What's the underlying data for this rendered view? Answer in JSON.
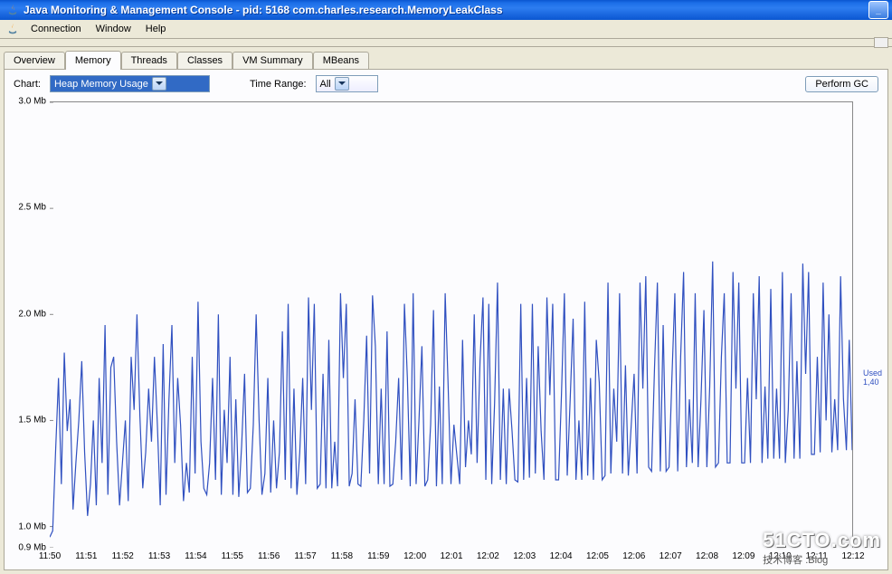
{
  "window": {
    "title": "Java Monitoring & Management Console - pid: 5168 com.charles.research.MemoryLeakClass"
  },
  "menubar": {
    "items": [
      "Connection",
      "Window",
      "Help"
    ]
  },
  "tabs": {
    "items": [
      "Overview",
      "Memory",
      "Threads",
      "Classes",
      "VM Summary",
      "MBeans"
    ],
    "active": 1
  },
  "controls": {
    "chart_label": "Chart:",
    "chart_value": "Heap Memory Usage",
    "time_label": "Time Range:",
    "time_value": "All",
    "gc_button": "Perform GC"
  },
  "sidelabel": {
    "l1": "Used",
    "l2": "1,40"
  },
  "watermark": {
    "main": "51CTO.com",
    "sub": "技术博客 .Blog"
  },
  "chart_data": {
    "type": "line",
    "title": "",
    "xlabel": "",
    "ylabel": "",
    "y_unit": "Mb",
    "ylim": [
      0.9,
      3.0
    ],
    "y_ticks": [
      0.9,
      1.0,
      1.5,
      2.0,
      2.5,
      3.0
    ],
    "y_tick_labels": [
      "0.9 Mb",
      "1.0 Mb",
      "1.5 Mb",
      "2.0 Mb",
      "2.5 Mb",
      "3.0 Mb"
    ],
    "x_tick_labels": [
      "11:50",
      "11:51",
      "11:52",
      "11:53",
      "11:54",
      "11:55",
      "11:56",
      "11:57",
      "11:58",
      "11:59",
      "12:00",
      "12:01",
      "12:02",
      "12:03",
      "12:04",
      "12:05",
      "12:06",
      "12:07",
      "12:08",
      "12:09",
      "12:10",
      "12:11",
      "12:12"
    ],
    "x_range": [
      0,
      276
    ],
    "series": [
      {
        "name": "Used",
        "color": "#3050c0",
        "values": [
          0.95,
          0.98,
          1.35,
          1.7,
          1.2,
          1.82,
          1.45,
          1.6,
          1.08,
          1.3,
          1.5,
          1.78,
          1.35,
          1.05,
          1.2,
          1.5,
          1.1,
          1.7,
          1.3,
          1.95,
          1.15,
          1.75,
          1.8,
          1.4,
          1.1,
          1.3,
          1.5,
          1.12,
          1.8,
          1.55,
          2.0,
          1.52,
          1.18,
          1.35,
          1.65,
          1.4,
          1.8,
          1.48,
          1.1,
          1.86,
          1.15,
          1.6,
          1.95,
          1.3,
          1.7,
          1.48,
          1.12,
          1.3,
          1.16,
          1.8,
          1.25,
          2.06,
          1.4,
          1.18,
          1.15,
          1.3,
          1.7,
          1.22,
          2.0,
          1.15,
          1.55,
          1.3,
          1.8,
          1.15,
          1.6,
          1.14,
          1.38,
          1.72,
          1.16,
          1.18,
          1.48,
          2.0,
          1.5,
          1.15,
          1.25,
          1.7,
          1.16,
          1.5,
          1.18,
          1.35,
          1.92,
          1.22,
          2.05,
          1.18,
          1.65,
          1.15,
          1.35,
          1.7,
          1.2,
          2.08,
          1.55,
          2.05,
          1.18,
          1.2,
          1.72,
          1.18,
          1.88,
          1.18,
          1.4,
          1.19,
          2.1,
          1.7,
          2.05,
          1.19,
          1.25,
          1.6,
          1.2,
          1.19,
          1.5,
          1.9,
          1.25,
          2.09,
          1.85,
          1.2,
          1.65,
          1.2,
          1.92,
          1.19,
          1.2,
          1.4,
          1.7,
          1.22,
          2.05,
          1.7,
          1.19,
          2.1,
          1.2,
          1.5,
          1.85,
          1.19,
          1.22,
          1.48,
          2.02,
          1.19,
          1.66,
          1.2,
          2.1,
          1.68,
          1.2,
          1.48,
          1.34,
          1.2,
          1.88,
          1.28,
          1.5,
          1.34,
          2.0,
          1.3,
          1.78,
          2.08,
          1.22,
          2.05,
          1.2,
          1.58,
          2.15,
          1.22,
          1.65,
          1.2,
          1.65,
          1.45,
          1.22,
          1.21,
          2.05,
          1.22,
          1.7,
          1.23,
          2.05,
          1.25,
          1.85,
          1.45,
          1.22,
          2.08,
          1.62,
          2.05,
          1.22,
          1.22,
          1.62,
          2.1,
          1.24,
          1.6,
          1.98,
          1.22,
          1.5,
          1.22,
          2.06,
          1.24,
          1.7,
          1.22,
          1.88,
          1.68,
          1.22,
          1.24,
          2.15,
          1.25,
          1.65,
          1.4,
          2.1,
          1.25,
          1.76,
          1.24,
          1.48,
          1.72,
          1.25,
          2.15,
          1.65,
          2.18,
          1.28,
          1.26,
          1.75,
          2.15,
          1.26,
          1.95,
          1.26,
          1.28,
          1.7,
          2.1,
          1.26,
          1.8,
          2.2,
          1.28,
          1.6,
          1.3,
          2.1,
          1.28,
          1.6,
          2.02,
          1.28,
          1.66,
          2.25,
          1.28,
          1.3,
          1.8,
          2.1,
          1.3,
          1.3,
          2.2,
          1.65,
          2.15,
          1.3,
          1.3,
          1.7,
          1.3,
          2.1,
          1.6,
          2.18,
          1.3,
          1.66,
          1.32,
          2.12,
          1.32,
          1.65,
          1.32,
          2.2,
          1.3,
          1.55,
          2.1,
          1.32,
          1.78,
          1.32,
          2.24,
          1.72,
          2.2,
          1.34,
          1.34,
          1.8,
          1.35,
          2.15,
          1.5,
          2.0,
          1.35,
          1.6,
          1.36,
          2.18,
          1.6,
          1.36,
          1.88,
          1.36
        ]
      }
    ]
  }
}
